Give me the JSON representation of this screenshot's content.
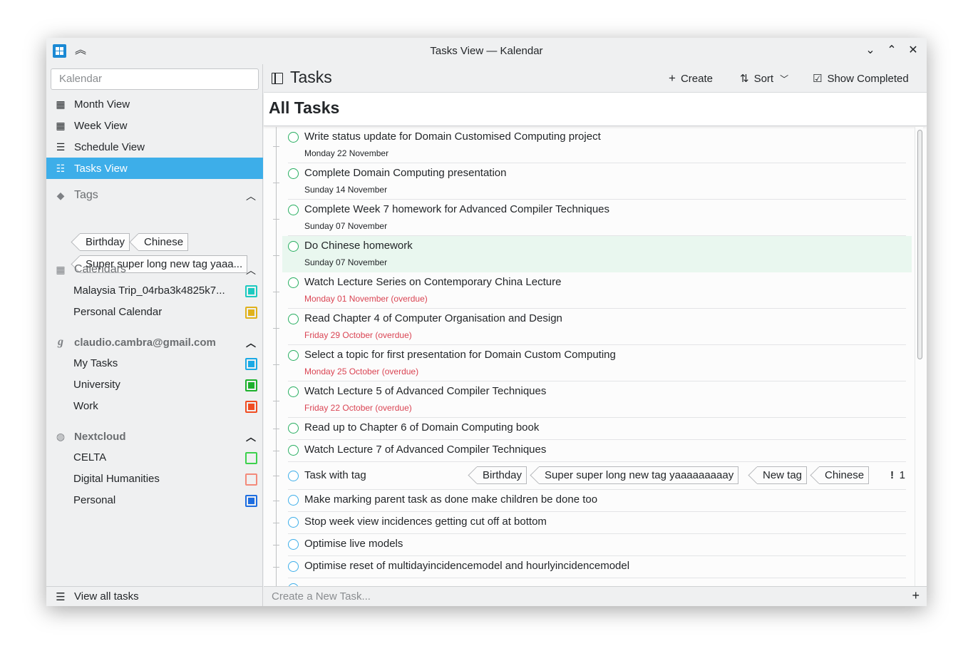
{
  "window": {
    "title": "Tasks View — Kalendar",
    "controls": {
      "minimize": "⌄",
      "maximize": "⌃",
      "close": "✕"
    }
  },
  "sidebar": {
    "search_placeholder": "Kalendar",
    "nav": [
      {
        "label": "Month View",
        "icon": "calendar-month-icon"
      },
      {
        "label": "Week View",
        "icon": "calendar-week-icon"
      },
      {
        "label": "Schedule View",
        "icon": "schedule-icon"
      },
      {
        "label": "Tasks View",
        "icon": "tasks-icon",
        "active": true
      }
    ],
    "tags": {
      "heading": "Tags",
      "items": [
        "Birthday",
        "Chinese",
        "Super super long new tag yaaa..."
      ]
    },
    "calendars": {
      "heading": "Calendars",
      "items": [
        {
          "name": "Malaysia Trip_04rba3k4825k7...",
          "color": "#1ccac0",
          "filled": true
        },
        {
          "name": "Personal Calendar",
          "color": "#e0b21c",
          "filled": true
        }
      ]
    },
    "google": {
      "heading": "claudio.cambra@gmail.com",
      "items": [
        {
          "name": "My Tasks",
          "color": "#1aa9e5",
          "filled": true
        },
        {
          "name": "University",
          "color": "#1db12d",
          "filled": true
        },
        {
          "name": "Work",
          "color": "#f04d22",
          "filled": true
        }
      ]
    },
    "nextcloud": {
      "heading": "Nextcloud",
      "items": [
        {
          "name": "CELTA",
          "color": "#3dd14d",
          "filled": false
        },
        {
          "name": "Digital Humanities",
          "color": "#f38a7a",
          "filled": false
        },
        {
          "name": "Personal",
          "color": "#1e6ee0",
          "filled": true
        }
      ]
    },
    "footer_label": "View all tasks"
  },
  "toolbar": {
    "heading": "Tasks",
    "create_label": "Create",
    "sort_label": "Sort",
    "show_completed_label": "Show Completed"
  },
  "main": {
    "page_title": "All Tasks",
    "tasks": [
      {
        "title": "Write status update for Domain Customised Computing project",
        "due": "Monday 22 November",
        "overdue": false
      },
      {
        "title": "Complete Domain Computing presentation",
        "due": "Sunday 14 November",
        "overdue": false
      },
      {
        "title": "Complete Week 7 homework for Advanced Compiler Techniques",
        "due": "Sunday 07 November",
        "overdue": false
      },
      {
        "title": "Do Chinese homework",
        "due": "Sunday 07 November",
        "overdue": false
      },
      {
        "title": "Watch Lecture Series on Contemporary China Lecture",
        "due": "Monday 01 November (overdue)",
        "overdue": true
      },
      {
        "title": "Read Chapter 4 of Computer Organisation and Design",
        "due": "Friday 29 October (overdue)",
        "overdue": true
      },
      {
        "title": "Select a topic for first presentation for Domain Custom Computing",
        "due": "Monday 25 October (overdue)",
        "overdue": true
      },
      {
        "title": "Watch Lecture 5 of Advanced Compiler Techniques",
        "due": "Friday 22 October (overdue)",
        "overdue": true
      },
      {
        "title": "Read up to Chapter 6 of Domain Computing book"
      },
      {
        "title": "Watch Lecture 7 of Advanced Compiler Techniques"
      },
      {
        "title": "Task with tag",
        "tags": [
          "Birthday",
          "Super super long new tag yaaaaaaaaay",
          "New tag",
          "Chinese"
        ],
        "priority_icon": "!",
        "priority": "1"
      },
      {
        "title": "Make marking parent task as done make children be done too"
      },
      {
        "title": "Stop week view incidences getting cut off at bottom"
      },
      {
        "title": "Optimise live models"
      },
      {
        "title": "Optimise reset of multidayincidencemodel and hourlyincidencemodel"
      }
    ],
    "new_task_placeholder": "Create a New Task...",
    "add_symbol": "+"
  }
}
